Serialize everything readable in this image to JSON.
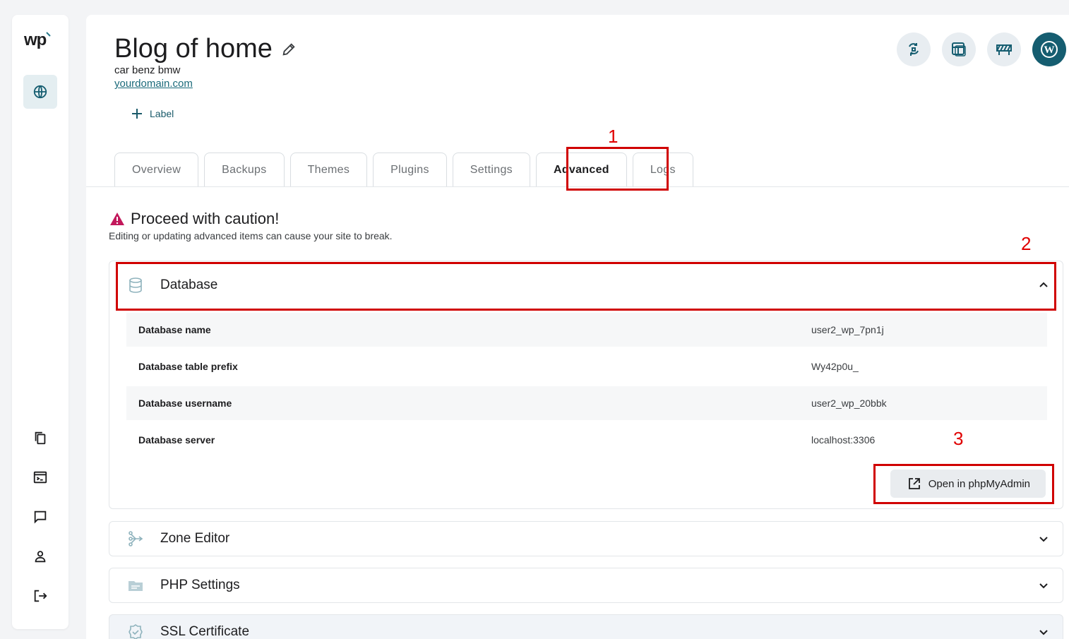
{
  "sidebar": {
    "logo": "wp",
    "items": [
      "globe-icon",
      "copy-icon",
      "terminal-icon",
      "chat-icon",
      "user-icon",
      "logout-icon"
    ]
  },
  "site": {
    "title": "Blog of home",
    "subtitle": "car benz bmw",
    "domain": "yourdomain.com",
    "add_label": "Label"
  },
  "tabs": [
    {
      "label": "Overview"
    },
    {
      "label": "Backups"
    },
    {
      "label": "Themes"
    },
    {
      "label": "Plugins"
    },
    {
      "label": "Settings"
    },
    {
      "label": "Advanced",
      "active": true
    },
    {
      "label": "Logs"
    }
  ],
  "caution": {
    "title": "Proceed with caution!",
    "text": "Editing or updating advanced items can cause your site to break."
  },
  "database": {
    "title": "Database",
    "rows": [
      {
        "label": "Database name",
        "value": "user2_wp_7pn1j"
      },
      {
        "label": "Database table prefix",
        "value": "Wy42p0u_"
      },
      {
        "label": "Database username",
        "value": "user2_wp_20bbk"
      },
      {
        "label": "Database server",
        "value": "localhost:3306"
      }
    ],
    "button": "Open in phpMyAdmin"
  },
  "sections": {
    "zone": "Zone Editor",
    "php": "PHP Settings",
    "ssl": "SSL Certificate"
  },
  "annotations": [
    "1",
    "2",
    "3"
  ],
  "colors": {
    "accent": "#155d70",
    "annotation": "#d00000",
    "warning": "#c2185b"
  }
}
